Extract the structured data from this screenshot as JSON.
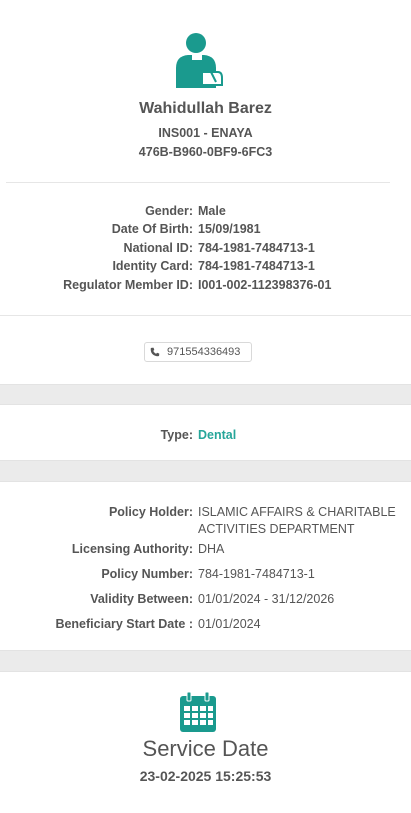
{
  "profile": {
    "name": "Wahidullah Barez",
    "insurer": "INS001 - ENAYA",
    "code": "476B-B960-0BF9-6FC3",
    "details": [
      {
        "label": "Gender:",
        "value": "Male"
      },
      {
        "label": "Date Of Birth:",
        "value": "15/09/1981"
      },
      {
        "label": "National ID:",
        "value": "784-1981-7484713-1"
      },
      {
        "label": "Identity Card:",
        "value": "784-1981-7484713-1"
      },
      {
        "label": "Regulator Member ID:",
        "value": "I001-002-112398376-01"
      }
    ],
    "phone": "971554336493"
  },
  "coverage": {
    "type_label": "Type:",
    "type_value": "Dental",
    "type_color": "#26a69a"
  },
  "policy": {
    "rows": [
      {
        "label": "Policy Holder:",
        "value": "ISLAMIC AFFAIRS & CHARITABLE ACTIVITIES DEPARTMENT"
      },
      {
        "label": "Licensing Authority:",
        "value": "DHA"
      },
      {
        "label": "Policy Number:",
        "value": "784-1981-7484713-1"
      },
      {
        "label": "Validity Between:",
        "value": "01/01/2024 - 31/12/2026"
      },
      {
        "label": "Beneficiary Start Date :",
        "value": "01/01/2024"
      }
    ]
  },
  "service": {
    "title": "Service Date",
    "date": "23-02-2025 15:25:53"
  },
  "icons": {
    "avatar": "user-injured-icon",
    "phone": "phone-icon",
    "calendar": "calendar-icon",
    "accent": "#26a69a"
  }
}
